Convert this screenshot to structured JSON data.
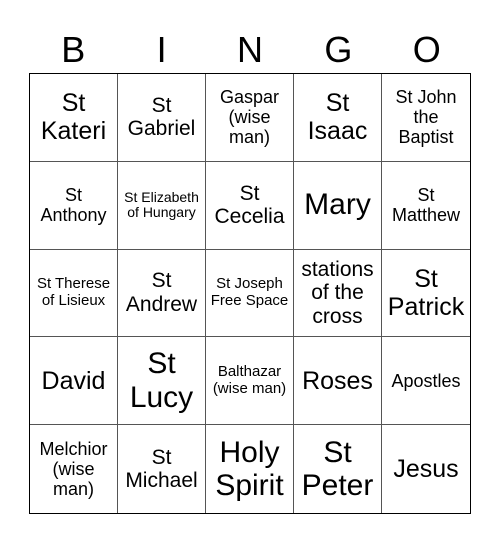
{
  "header": [
    "B",
    "I",
    "N",
    "G",
    "O"
  ],
  "cells": [
    {
      "text": "St Kateri",
      "size": "s-l"
    },
    {
      "text": "St Gabriel",
      "size": "s-m"
    },
    {
      "text": "Gaspar (wise man)",
      "size": "s-sm"
    },
    {
      "text": "St Isaac",
      "size": "s-l"
    },
    {
      "text": "St John the Baptist",
      "size": "s-sm"
    },
    {
      "text": "St Anthony",
      "size": "s-sm"
    },
    {
      "text": "St Elizabeth of Hungary",
      "size": "s-xs"
    },
    {
      "text": "St Cecelia",
      "size": "s-m"
    },
    {
      "text": "Mary",
      "size": "s-xl"
    },
    {
      "text": "St Matthew",
      "size": "s-sm"
    },
    {
      "text": "St Therese of Lisieux",
      "size": "s-s"
    },
    {
      "text": "St Andrew",
      "size": "s-m"
    },
    {
      "text": "St Joseph Free Space",
      "size": "s-s"
    },
    {
      "text": "stations of the cross",
      "size": "s-m"
    },
    {
      "text": "St Patrick",
      "size": "s-l"
    },
    {
      "text": "David",
      "size": "s-l"
    },
    {
      "text": "St Lucy",
      "size": "s-xl"
    },
    {
      "text": "Balthazar (wise man)",
      "size": "s-s"
    },
    {
      "text": "Roses",
      "size": "s-l"
    },
    {
      "text": "Apostles",
      "size": "s-sm"
    },
    {
      "text": "Melchior (wise man)",
      "size": "s-sm"
    },
    {
      "text": "St Michael",
      "size": "s-m"
    },
    {
      "text": "Holy Spirit",
      "size": "s-xl"
    },
    {
      "text": "St Peter",
      "size": "s-xl"
    },
    {
      "text": "Jesus",
      "size": "s-l"
    }
  ]
}
